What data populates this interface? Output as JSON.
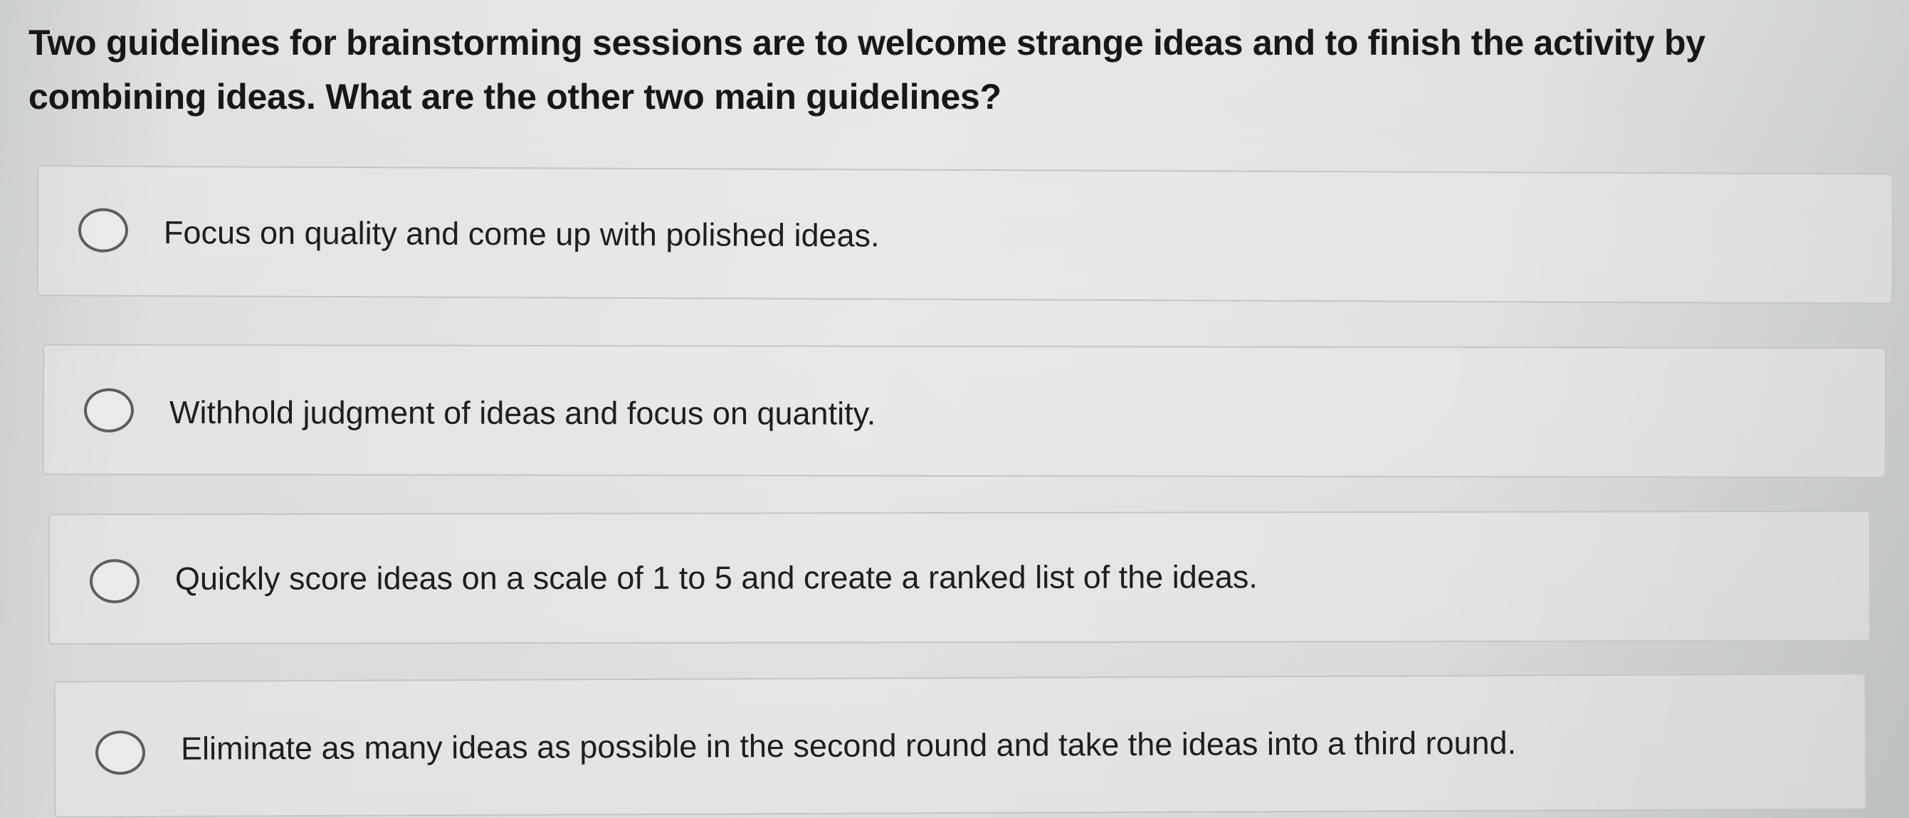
{
  "question": {
    "text": "Two guidelines for brainstorming sessions are to welcome strange ideas and to finish the activity by combining ideas. What are the other two main guidelines?"
  },
  "options": [
    {
      "label": "Focus on quality and come up with polished ideas.",
      "selected": false
    },
    {
      "label": "Withhold judgment of ideas and focus on quantity.",
      "selected": false
    },
    {
      "label": "Quickly score ideas on a scale of 1 to 5 and create a ranked list of the ideas.",
      "selected": false
    },
    {
      "label": "Eliminate as many ideas as possible in the second round and take the ideas into a third round.",
      "selected": false
    }
  ]
}
